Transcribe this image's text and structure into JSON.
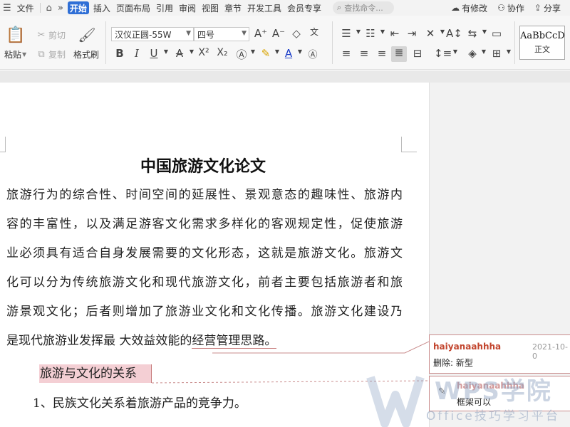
{
  "menubar": {
    "file": "文件",
    "more": "»",
    "tabs": [
      "开始",
      "插入",
      "页面布局",
      "引用",
      "审阅",
      "视图",
      "章节",
      "开发工具",
      "会员专享"
    ],
    "search_placeholder": "查找命令...",
    "right": {
      "changes": "有修改",
      "collab": "协作",
      "share": "分享"
    }
  },
  "toolbar": {
    "paste": "粘贴",
    "cut": "剪切",
    "copy": "复制",
    "format_painter": "格式刷",
    "font_name": "汉仪正圆-55W",
    "font_size": "四号",
    "bold": "B",
    "italic": "I",
    "underline": "U",
    "superscript": "X²",
    "subscript": "X₂",
    "style_sample": "AaBbCcDd",
    "style_name": "正文"
  },
  "document": {
    "title": "中国旅游文化论文",
    "paragraph_lines": [
      "旅游行为的综合性、时间空间的延展性、景观意态的趣味性、旅游内",
      "容的丰富性，以及满足游客文化需求多样化的客观规定性，促使旅游",
      "业必须具有适合自身发展需要的文化形态，这就是旅游文化。旅游文",
      "化可以分为传统旅游文化和现代旅游文化，前者主要包括旅游者和旅",
      "游景观文化；后者则增加了旅游业文化和文化传播。旅游文化建设乃"
    ],
    "last_line_before": "是现代旅游业发挥最 大效益效能的",
    "last_line_marked": "经营管理思路。",
    "heading": "旅游与文化的关系",
    "list_item_1": "1、民族文化关系着旅游产品的竞争力。",
    "list_item_2_partial": "…  …  …  …  …  …  …  …  …"
  },
  "comments": [
    {
      "author": "haiyanaahhha",
      "date": "2021-10-0",
      "label": "删除:",
      "text": "新型"
    },
    {
      "author": "haiyanaahhha",
      "text": "框架可以"
    }
  ],
  "watermark": {
    "brand": "WPS学院",
    "slogan": "Office技巧学习平台"
  }
}
